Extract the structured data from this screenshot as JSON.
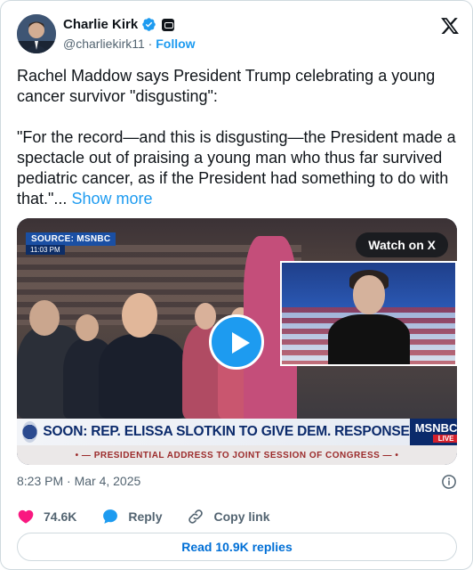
{
  "author": {
    "name": "Charlie Kirk",
    "handle": "@charliekirk11",
    "separator": "·",
    "follow_label": "Follow",
    "avatar_icon": "avatar",
    "verified_icon": "verified-badge-icon",
    "affiliate_icon": "affiliate-badge-icon"
  },
  "platform_icon": "x-logo-icon",
  "tweet": {
    "text": "Rachel Maddow says President Trump celebrating a young cancer survivor \"disgusting\":\n\n\"For the record—and this is disgusting—the President made a spectacle out of praising a young man who thus far survived pediatric cancer, as if the President had something to do with that.\"...",
    "show_more": "Show more"
  },
  "media": {
    "source_tag": "SOURCE: MSNBC",
    "source_time": "11:03 PM",
    "watch_label": "Watch on X",
    "lower_third": "SOON: REP. ELISSA SLOTKIN TO GIVE DEM. RESPONSE",
    "network": "MSNBC",
    "live_label": "LIVE",
    "ticker": "• — PRESIDENTIAL ADDRESS TO JOINT SESSION OF CONGRESS — •",
    "play_icon": "play-icon"
  },
  "meta": {
    "timestamp": "8:23 PM · Mar 4, 2025",
    "info_icon": "info-icon"
  },
  "actions": {
    "likes": "74.6K",
    "reply_label": "Reply",
    "copy_label": "Copy link"
  },
  "read_replies": "Read 10.9K replies",
  "colors": {
    "accent": "#1d9bf0",
    "like": "#f91880",
    "link": "#006fd6",
    "secondary_text": "#536471"
  }
}
